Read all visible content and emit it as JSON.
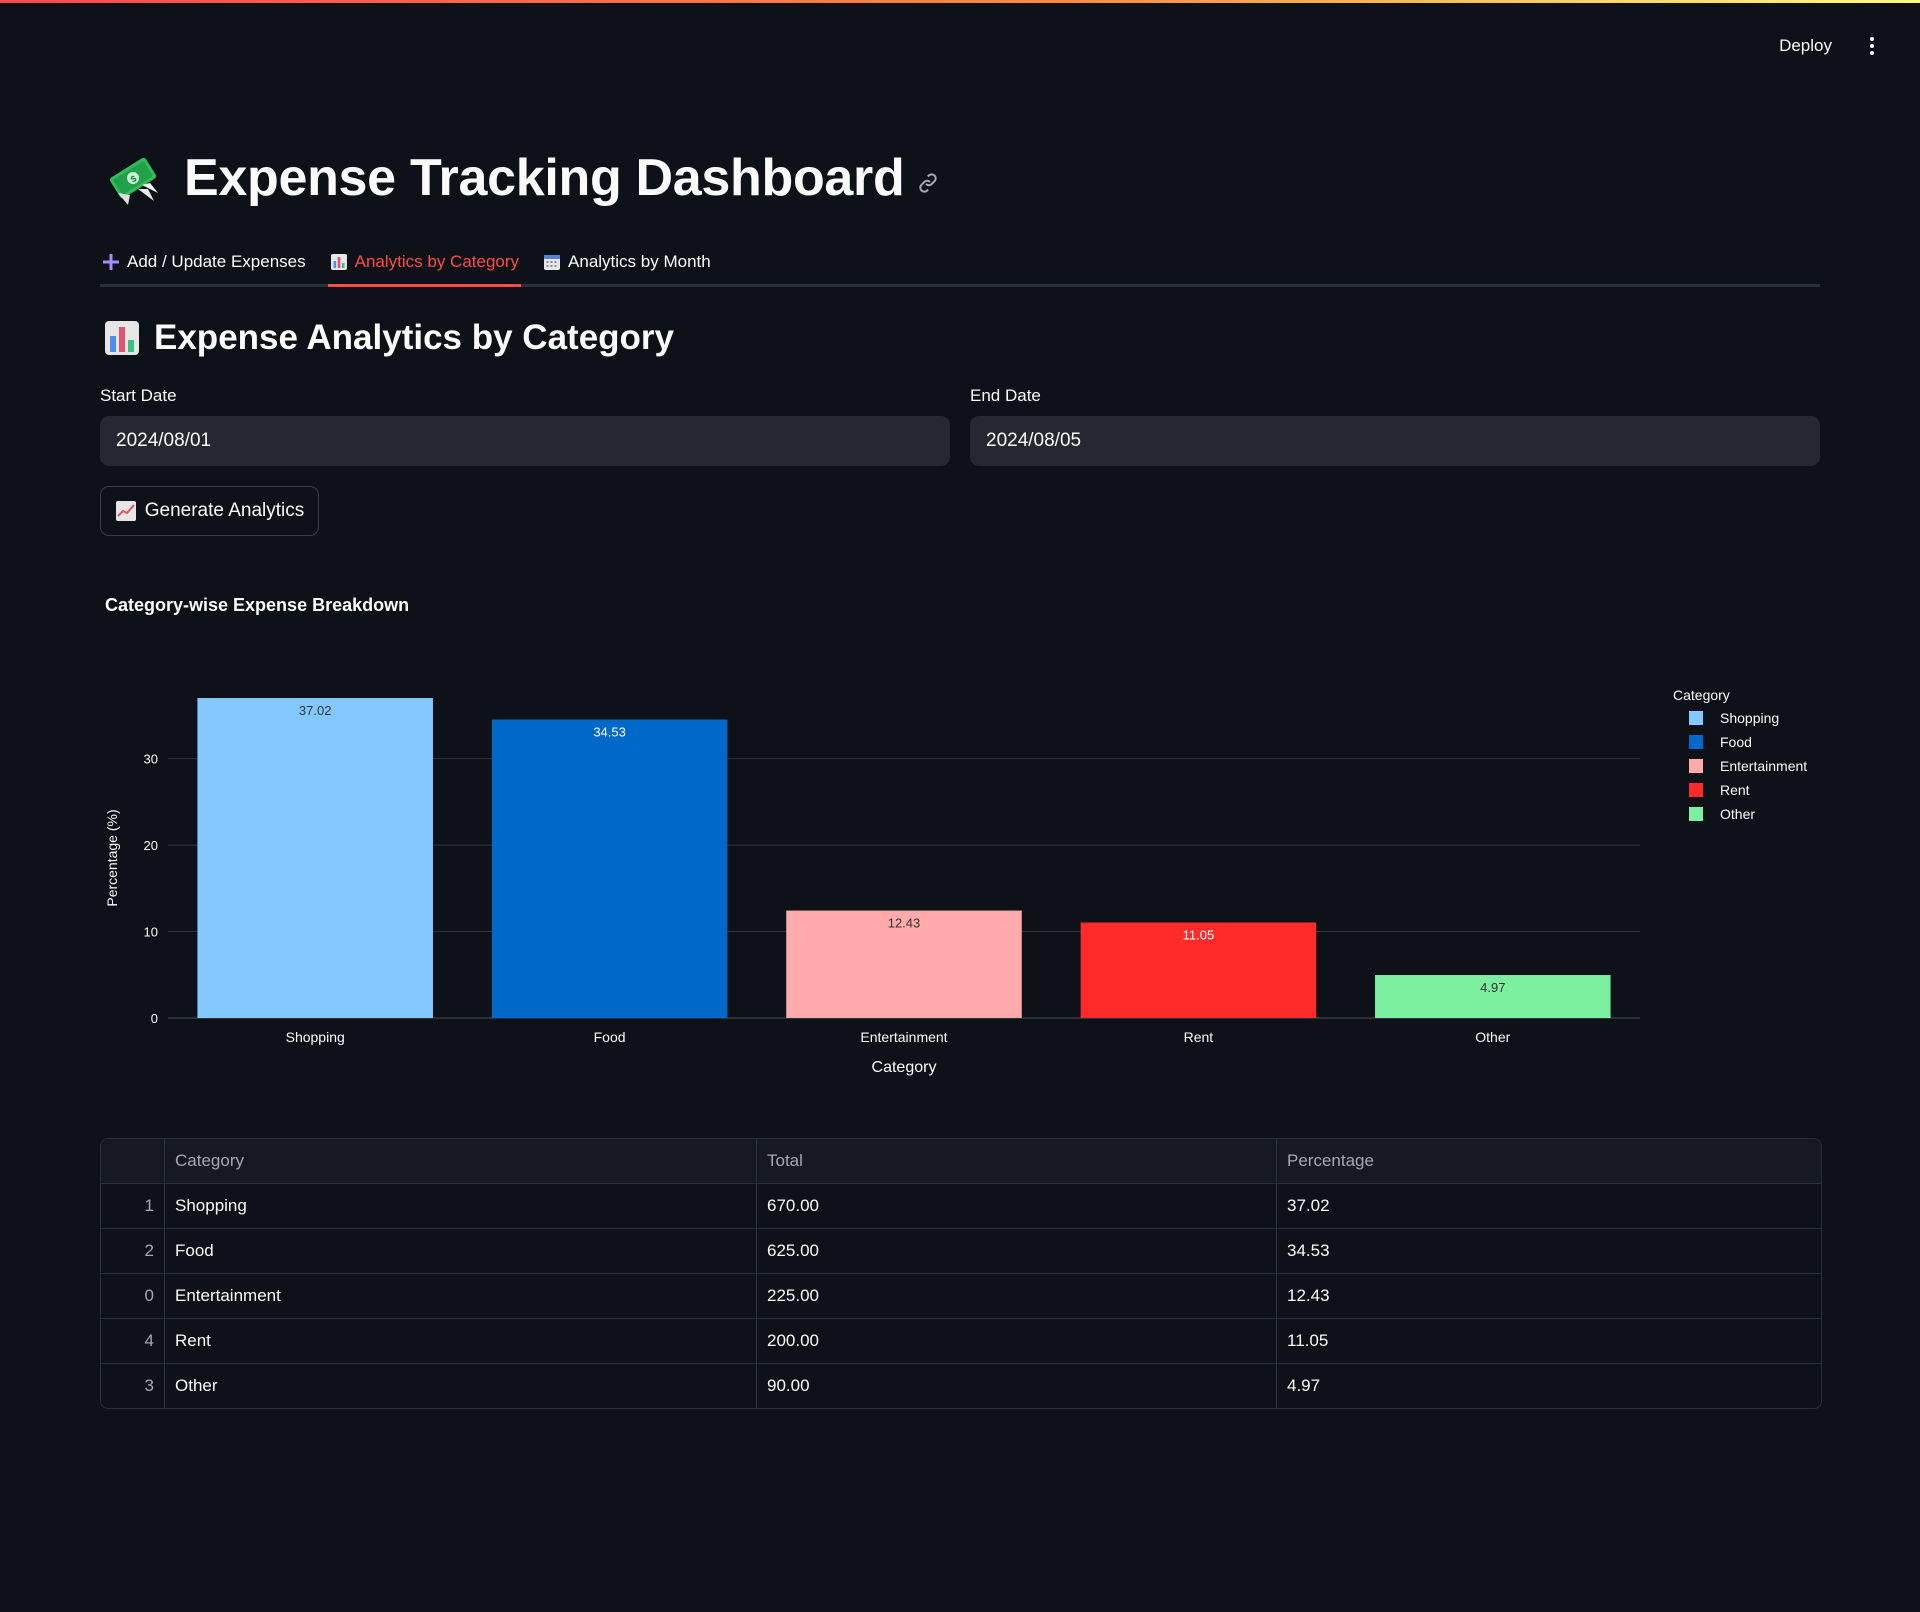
{
  "header": {
    "deploy_label": "Deploy"
  },
  "page": {
    "title": "Expense Tracking Dashboard"
  },
  "tabs": [
    {
      "label": "Add / Update Expenses",
      "icon": "plus-icon",
      "active": false
    },
    {
      "label": "Analytics by Category",
      "icon": "bar-chart-icon",
      "active": true
    },
    {
      "label": "Analytics by Month",
      "icon": "calendar-icon",
      "active": false
    }
  ],
  "section": {
    "title": "Expense Analytics by Category"
  },
  "form": {
    "start_date_label": "Start Date",
    "start_date_value": "2024/08/01",
    "end_date_label": "End Date",
    "end_date_value": "2024/08/05",
    "generate_label": "Generate Analytics"
  },
  "colors": {
    "accent": "#ff4b4b",
    "background": "#0e1117",
    "input_bg": "#262730"
  },
  "chart_data": {
    "type": "bar",
    "title": "Category-wise Expense Breakdown",
    "xlabel": "Category",
    "ylabel": "Percentage (%)",
    "ylim": [
      0,
      37.02
    ],
    "yticks": [
      0,
      10,
      20,
      30
    ],
    "grid": true,
    "legend_title": "Category",
    "legend_position": "top-right",
    "categories": [
      "Shopping",
      "Food",
      "Entertainment",
      "Rent",
      "Other"
    ],
    "values": [
      37.02,
      34.53,
      12.43,
      11.05,
      4.97
    ],
    "value_labels": [
      "37.02",
      "34.53",
      "12.43",
      "11.05",
      "4.97"
    ],
    "colors": [
      "#83c9ff",
      "#0068c9",
      "#ffabab",
      "#ff2b2b",
      "#7defa1"
    ],
    "label_colors": [
      "#333333",
      "#ffffff",
      "#333333",
      "#ffffff",
      "#333333"
    ]
  },
  "table": {
    "columns": [
      "",
      "Category",
      "Total",
      "Percentage"
    ],
    "rows": [
      [
        "1",
        "Shopping",
        "670.00",
        "37.02"
      ],
      [
        "2",
        "Food",
        "625.00",
        "34.53"
      ],
      [
        "0",
        "Entertainment",
        "225.00",
        "12.43"
      ],
      [
        "4",
        "Rent",
        "200.00",
        "11.05"
      ],
      [
        "3",
        "Other",
        "90.00",
        "4.97"
      ]
    ]
  }
}
